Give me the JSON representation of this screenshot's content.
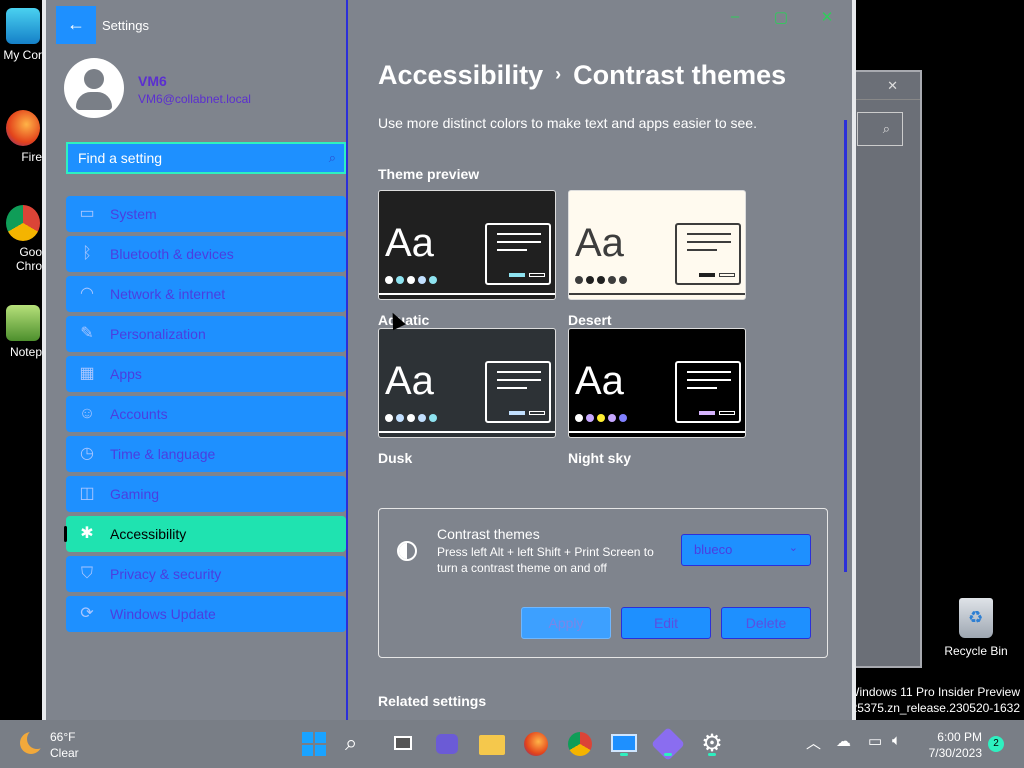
{
  "desktop": {
    "icons": [
      {
        "label": "My Cor",
        "name": "this-pc-icon"
      },
      {
        "label": "Fire",
        "name": "firefox-icon"
      },
      {
        "label": "Goo Chro",
        "name": "chrome-icon"
      },
      {
        "label": "Notep",
        "name": "notepad-icon"
      }
    ],
    "recycle_bin": "Recycle Bin",
    "watermark": [
      "Windows 11 Pro Insider Preview",
      "d 25375.zn_release.230520-1632"
    ]
  },
  "window": {
    "title": "Settings",
    "controls": {
      "minimize": "–",
      "maximize": "▢",
      "close": "✕"
    }
  },
  "user": {
    "name": "VM6",
    "email": "VM6@collabnet.local"
  },
  "search": {
    "placeholder": "Find a setting"
  },
  "nav": [
    {
      "label": "System",
      "icon": "display-icon",
      "glyph": "▭"
    },
    {
      "label": "Bluetooth & devices",
      "icon": "bluetooth-icon",
      "glyph": "ᛒ"
    },
    {
      "label": "Network & internet",
      "icon": "wifi-icon",
      "glyph": "◠"
    },
    {
      "label": "Personalization",
      "icon": "brush-icon",
      "glyph": "✎"
    },
    {
      "label": "Apps",
      "icon": "apps-icon",
      "glyph": "▦"
    },
    {
      "label": "Accounts",
      "icon": "person-icon",
      "glyph": "☺"
    },
    {
      "label": "Time & language",
      "icon": "globe-clock-icon",
      "glyph": "◷"
    },
    {
      "label": "Gaming",
      "icon": "gamepad-icon",
      "glyph": "◫"
    },
    {
      "label": "Accessibility",
      "icon": "accessibility-icon",
      "glyph": "✱",
      "active": true
    },
    {
      "label": "Privacy & security",
      "icon": "shield-icon",
      "glyph": "⛉"
    },
    {
      "label": "Windows Update",
      "icon": "update-icon",
      "glyph": "⟳"
    }
  ],
  "main": {
    "breadcrumb_parent": "Accessibility",
    "breadcrumb_sep": "›",
    "breadcrumb_current": "Contrast themes",
    "description": "Use more distinct colors to make text and apps easier to see.",
    "theme_preview_label": "Theme preview",
    "themes": [
      {
        "name": "Aquatic",
        "bg": "#202020",
        "fg": "#ffffff",
        "dots": [
          "#ffffff",
          "#8ee3f0",
          "#ffffff",
          "#c2e0ff",
          "#8ee3f0"
        ],
        "accent": "#8ee3f0"
      },
      {
        "name": "Desert",
        "bg": "#fffaef",
        "fg": "#3d3d3d",
        "dots": [
          "#3d3d3d",
          "#202020",
          "#202020",
          "#3d3d3d",
          "#3d3d3d"
        ],
        "accent": "#202020"
      },
      {
        "name": "Dusk",
        "bg": "#2d3236",
        "fg": "#ffffff",
        "dots": [
          "#ffffff",
          "#c2e0ff",
          "#ffffff",
          "#c2e0ff",
          "#8ee3f0"
        ],
        "accent": "#c2e0ff"
      },
      {
        "name": "Night sky",
        "bg": "#000000",
        "fg": "#ffffff",
        "dots": [
          "#ffffff",
          "#c6a7ff",
          "#ffee32",
          "#c6a7ff",
          "#8080ff"
        ],
        "accent": "#d6b4fd"
      }
    ],
    "contrast_box": {
      "title": "Contrast themes",
      "hint": "Press left Alt + left Shift + Print Screen to turn a contrast theme on and off",
      "selected_theme": "blueco",
      "buttons": {
        "apply": "Apply",
        "edit": "Edit",
        "delete": "Delete"
      }
    },
    "related_settings": "Related settings"
  },
  "taskbar": {
    "weather_temp": "66°F",
    "weather_cond": "Clear",
    "time": "6:00 PM",
    "date": "7/30/2023",
    "notification_count": "2"
  },
  "colors": {
    "accent": "#1e90ff",
    "active": "#1fe3b0",
    "border": "#2b2fd9"
  }
}
